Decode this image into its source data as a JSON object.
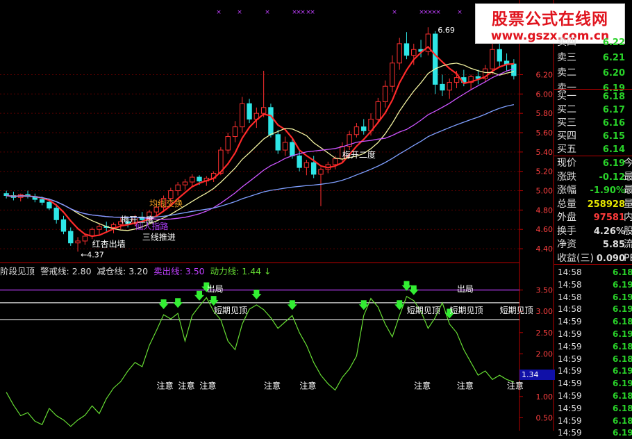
{
  "watermark": {
    "title": "股票公式在线网",
    "url": "www.gszx.com.cn"
  },
  "quote": {
    "ask": [
      {
        "label": "卖四",
        "value": "6.22"
      },
      {
        "label": "卖三",
        "value": "6.21"
      },
      {
        "label": "卖二",
        "value": "6.20"
      },
      {
        "label": "卖一",
        "value": "6.19"
      }
    ],
    "bid": [
      {
        "label": "买一",
        "value": "6.18"
      },
      {
        "label": "买二",
        "value": "6.17"
      },
      {
        "label": "买三",
        "value": "6.16"
      },
      {
        "label": "买四",
        "value": "6.15"
      },
      {
        "label": "买五",
        "value": "6.14"
      }
    ],
    "stats": [
      {
        "label": "现价",
        "value": "6.19",
        "color": "#29d129",
        "tail": "今"
      },
      {
        "label": "涨跌",
        "value": "-0.12",
        "color": "#29d129",
        "tail": "最"
      },
      {
        "label": "涨幅",
        "value": "-1.90%",
        "color": "#29d129",
        "tail": "最"
      },
      {
        "label": "总量",
        "value": "258928",
        "color": "#e8e800",
        "tail": "量"
      },
      {
        "label": "外盘",
        "value": "97581",
        "color": "#ff3b3b",
        "tail": "内"
      },
      {
        "label": "换手",
        "value": "4.26%",
        "color": "#dddddd",
        "tail": "股"
      },
      {
        "label": "净资",
        "value": "5.85",
        "color": "#dddddd",
        "tail": "流"
      },
      {
        "label": "收益(三)",
        "value": "0.090",
        "color": "#dddddd",
        "tail": "PE"
      }
    ],
    "ticks": [
      {
        "time": "14:58",
        "price": "6.18"
      },
      {
        "time": "14:58",
        "price": "6.19"
      },
      {
        "time": "14:58",
        "price": "6.19"
      },
      {
        "time": "14:58",
        "price": "6.19"
      },
      {
        "time": "14:59",
        "price": "6.18"
      },
      {
        "time": "14:59",
        "price": "6.19"
      },
      {
        "time": "14:59",
        "price": "6.18"
      },
      {
        "time": "14:59",
        "price": "6.18"
      },
      {
        "time": "14:59",
        "price": "6.19"
      },
      {
        "time": "14:59",
        "price": "6.19"
      },
      {
        "time": "14:59",
        "price": "6.18"
      },
      {
        "time": "14:59",
        "price": "6.18"
      },
      {
        "time": "14:59",
        "price": "6.18"
      },
      {
        "time": "14:59",
        "price": "6.19"
      }
    ]
  },
  "indicator_header": [
    {
      "text": "阶段见顶",
      "color": "#dddddd"
    },
    {
      "text": "警戒线: 2.80",
      "color": "#dddddd"
    },
    {
      "text": "减仓线: 3.20",
      "color": "#dddddd"
    },
    {
      "text": "卖出线: 3.50",
      "color": "#c040ff"
    },
    {
      "text": "动力线: 1.44 ↓",
      "color": "#66dd33"
    }
  ],
  "current_value_badge": "1.34",
  "chart_data": [
    {
      "type": "candlestick",
      "ylim": [
        4.3,
        6.9
      ],
      "yticks": [
        "6.20",
        "6.00",
        "5.80",
        "5.60",
        "5.40",
        "5.20",
        "5.00",
        "4.80",
        "4.60",
        "4.40"
      ],
      "high_label": "6.69",
      "low_label": "4.37",
      "ohlc": [
        [
          4.97,
          5.0,
          4.92,
          4.95
        ],
        [
          4.95,
          4.99,
          4.9,
          4.93
        ],
        [
          4.93,
          4.97,
          4.89,
          4.96
        ],
        [
          4.96,
          5.0,
          4.92,
          4.94
        ],
        [
          4.94,
          4.97,
          4.88,
          4.91
        ],
        [
          4.91,
          4.94,
          4.85,
          4.88
        ],
        [
          4.88,
          4.92,
          4.8,
          4.82
        ],
        [
          4.82,
          4.86,
          4.66,
          4.7
        ],
        [
          4.7,
          4.74,
          4.55,
          4.58
        ],
        [
          4.58,
          4.62,
          4.43,
          4.46
        ],
        [
          4.46,
          4.52,
          4.37,
          4.48
        ],
        [
          4.48,
          4.56,
          4.44,
          4.53
        ],
        [
          4.53,
          4.62,
          4.5,
          4.6
        ],
        [
          4.6,
          4.66,
          4.55,
          4.63
        ],
        [
          4.63,
          4.68,
          4.58,
          4.62
        ],
        [
          4.62,
          4.67,
          4.56,
          4.65
        ],
        [
          4.65,
          4.72,
          4.6,
          4.68
        ],
        [
          4.68,
          4.72,
          4.62,
          4.66
        ],
        [
          4.66,
          4.75,
          4.63,
          4.72
        ],
        [
          4.72,
          4.78,
          4.66,
          4.7
        ],
        [
          4.7,
          4.8,
          4.68,
          4.78
        ],
        [
          4.78,
          4.86,
          4.73,
          4.83
        ],
        [
          4.83,
          4.95,
          4.78,
          4.92
        ],
        [
          4.92,
          5.03,
          4.86,
          5.0
        ],
        [
          5.0,
          5.09,
          4.95,
          5.06
        ],
        [
          5.06,
          5.12,
          5.01,
          5.09
        ],
        [
          5.09,
          5.17,
          5.04,
          5.14
        ],
        [
          5.14,
          5.16,
          5.06,
          5.1
        ],
        [
          5.1,
          5.15,
          5.05,
          5.13
        ],
        [
          5.13,
          5.2,
          5.09,
          5.18
        ],
        [
          5.18,
          5.45,
          5.16,
          5.42
        ],
        [
          5.42,
          5.6,
          5.38,
          5.56
        ],
        [
          5.56,
          5.72,
          5.5,
          5.66
        ],
        [
          5.66,
          5.97,
          5.6,
          5.9
        ],
        [
          5.9,
          5.95,
          5.7,
          5.74
        ],
        [
          5.74,
          5.86,
          5.65,
          5.8
        ],
        [
          5.8,
          6.24,
          5.76,
          5.86
        ],
        [
          5.86,
          5.9,
          5.55,
          5.58
        ],
        [
          5.58,
          5.63,
          5.38,
          5.42
        ],
        [
          5.42,
          5.56,
          5.36,
          5.5
        ],
        [
          5.5,
          5.55,
          5.33,
          5.36
        ],
        [
          5.36,
          5.42,
          5.2,
          5.24
        ],
        [
          5.24,
          5.32,
          5.16,
          5.29
        ],
        [
          5.29,
          5.36,
          5.13,
          5.17
        ],
        [
          5.17,
          5.24,
          4.84,
          5.22
        ],
        [
          5.22,
          5.3,
          5.18,
          5.27
        ],
        [
          5.27,
          5.36,
          5.22,
          5.33
        ],
        [
          5.33,
          5.5,
          5.3,
          5.46
        ],
        [
          5.46,
          5.62,
          5.42,
          5.58
        ],
        [
          5.58,
          5.7,
          5.55,
          5.66
        ],
        [
          5.66,
          5.74,
          5.58,
          5.62
        ],
        [
          5.62,
          5.8,
          5.57,
          5.74
        ],
        [
          5.74,
          5.96,
          5.7,
          5.92
        ],
        [
          5.92,
          6.14,
          5.86,
          6.08
        ],
        [
          6.08,
          6.4,
          6.02,
          6.32
        ],
        [
          6.32,
          6.58,
          6.25,
          6.52
        ],
        [
          6.52,
          6.64,
          6.36,
          6.4
        ],
        [
          6.4,
          6.52,
          6.3,
          6.46
        ],
        [
          6.46,
          6.56,
          6.38,
          6.44
        ],
        [
          6.44,
          6.69,
          6.4,
          6.62
        ],
        [
          6.62,
          6.65,
          6.0,
          6.1
        ],
        [
          6.1,
          6.2,
          5.98,
          6.04
        ],
        [
          6.04,
          6.16,
          5.95,
          6.12
        ],
        [
          6.12,
          6.24,
          6.06,
          6.17
        ],
        [
          6.17,
          6.25,
          6.08,
          6.12
        ],
        [
          6.12,
          6.2,
          6.04,
          6.18
        ],
        [
          6.18,
          6.25,
          6.1,
          6.16
        ],
        [
          6.16,
          6.3,
          6.12,
          6.26
        ],
        [
          6.26,
          6.52,
          6.2,
          6.46
        ],
        [
          6.46,
          6.54,
          6.28,
          6.34
        ],
        [
          6.34,
          6.42,
          6.24,
          6.31
        ],
        [
          6.31,
          6.36,
          6.15,
          6.19
        ]
      ],
      "ma_series": [
        {
          "color": "#ff2a2a",
          "window": 5
        },
        {
          "color": "#f2f2a0",
          "window": 10
        },
        {
          "color": "#cc55ff",
          "window": 20
        },
        {
          "color": "#7f9fff",
          "window": 40
        }
      ],
      "annotations": [
        {
          "text": "梅开二度",
          "idx": 47,
          "price": 5.34,
          "color": "#ffffff"
        },
        {
          "text": "梅开二度",
          "idx": 16,
          "price": 4.67,
          "color": "#ffffff"
        },
        {
          "text": "均线交换",
          "idx": 20,
          "price": 4.84,
          "color": "#f2a020"
        },
        {
          "text": "仙人指路",
          "idx": 18,
          "price": 4.6,
          "color": "#b040ff"
        },
        {
          "text": "三线推进",
          "idx": 19,
          "price": 4.49,
          "color": "#ffffff"
        },
        {
          "text": "红杏出墙",
          "idx": 12,
          "price": 4.42,
          "color": "#ffffff"
        }
      ]
    },
    {
      "type": "line",
      "ylim": [
        0.28,
        3.85
      ],
      "yticks": [
        "3.50",
        "3.00",
        "2.50",
        "2.00",
        "1.50",
        "1.00",
        "0.50"
      ],
      "levels": [
        {
          "name": "卖出线",
          "value": 3.5,
          "color": "#c040ff"
        },
        {
          "name": "减仓线",
          "value": 3.2,
          "color": "#dddddd"
        },
        {
          "name": "警戒线",
          "value": 2.8,
          "color": "#dddddd"
        }
      ],
      "series": [
        {
          "name": "动力线",
          "color": "#66dd33",
          "values": [
            1.1,
            0.8,
            0.55,
            0.62,
            0.42,
            0.34,
            0.72,
            0.55,
            0.45,
            0.3,
            0.45,
            0.56,
            0.78,
            0.6,
            0.95,
            1.2,
            1.35,
            1.6,
            1.8,
            1.7,
            2.2,
            2.55,
            2.92,
            2.82,
            2.95,
            2.3,
            2.9,
            3.12,
            3.32,
            3.0,
            2.8,
            2.3,
            2.1,
            2.7,
            3.05,
            3.15,
            3.04,
            2.85,
            2.6,
            2.75,
            2.9,
            2.5,
            2.2,
            1.8,
            1.5,
            1.3,
            1.15,
            1.45,
            1.65,
            1.95,
            2.9,
            3.3,
            3.1,
            2.7,
            2.4,
            2.9,
            3.35,
            3.25,
            3.0,
            2.6,
            2.85,
            3.2,
            2.7,
            2.5,
            2.1,
            1.8,
            1.5,
            1.6,
            1.4,
            1.5,
            1.4,
            1.34
          ]
        }
      ],
      "signals": [
        {
          "idx": 22,
          "type": "arrow"
        },
        {
          "idx": 24,
          "type": "arrow"
        },
        {
          "idx": 27,
          "type": "arrow"
        },
        {
          "idx": 28,
          "type": "arrow"
        },
        {
          "idx": 29,
          "type": "arrow"
        },
        {
          "idx": 35,
          "type": "arrow"
        },
        {
          "idx": 40,
          "type": "arrow"
        },
        {
          "idx": 50,
          "type": "arrow"
        },
        {
          "idx": 55,
          "type": "arrow"
        },
        {
          "idx": 56,
          "type": "arrow"
        },
        {
          "idx": 57,
          "type": "arrow"
        },
        {
          "idx": 62,
          "type": "arrow"
        }
      ],
      "labels": [
        {
          "text": "出局",
          "idx": 29,
          "value": 3.52,
          "color": "#ffffff"
        },
        {
          "text": "出局",
          "idx": 64,
          "value": 3.52,
          "color": "#ffffff"
        },
        {
          "text": "短期见顶",
          "idx": 30,
          "value": 3.02,
          "color": "#ffffff"
        },
        {
          "text": "短期见顶",
          "idx": 57,
          "value": 3.02,
          "color": "#ffffff"
        },
        {
          "text": "短期见顶",
          "idx": 63,
          "value": 3.02,
          "color": "#ffffff"
        },
        {
          "text": "短期见顶",
          "idx": 70,
          "value": 3.02,
          "color": "#ffffff"
        },
        {
          "text": "注意",
          "idx": 22,
          "value": 1.25,
          "color": "#ffffff"
        },
        {
          "text": "注意",
          "idx": 25,
          "value": 1.25,
          "color": "#ffffff"
        },
        {
          "text": "注意",
          "idx": 28,
          "value": 1.25,
          "color": "#ffffff"
        },
        {
          "text": "注意",
          "idx": 37,
          "value": 1.25,
          "color": "#ffffff"
        },
        {
          "text": "注意",
          "idx": 42,
          "value": 1.25,
          "color": "#ffffff"
        },
        {
          "text": "注意",
          "idx": 58,
          "value": 1.25,
          "color": "#ffffff"
        },
        {
          "text": "注意",
          "idx": 64,
          "value": 1.25,
          "color": "#ffffff"
        },
        {
          "text": "注意",
          "idx": 71,
          "value": 1.25,
          "color": "#ffffff"
        }
      ]
    }
  ]
}
